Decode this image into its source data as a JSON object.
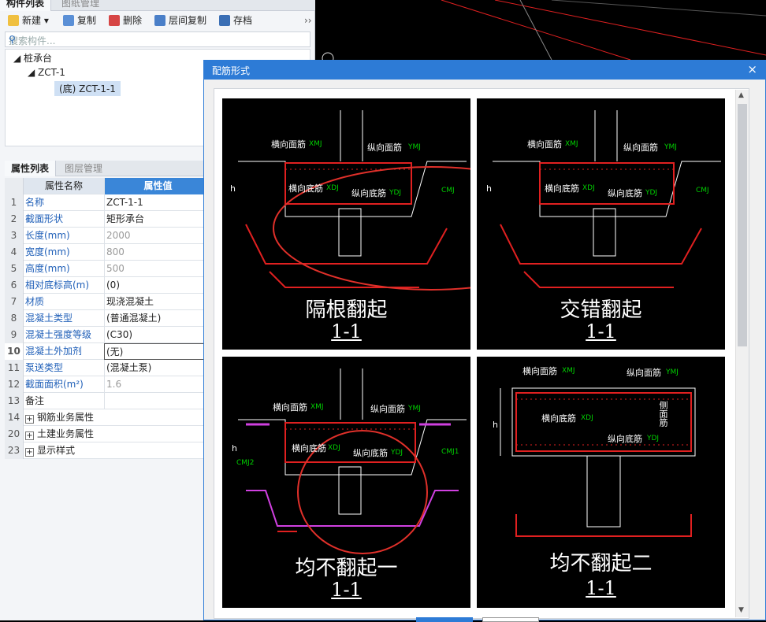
{
  "panel": {
    "tabs": [
      "构件列表",
      "图纸管理"
    ],
    "toolbar": {
      "new": "新建",
      "copy": "复制",
      "delete": "删除",
      "floor_copy": "层间复制",
      "save": "存档",
      "more": "››"
    },
    "search_placeholder": "搜索构件...",
    "tree": {
      "root": "桩承台",
      "child": "ZCT-1",
      "leaf": "(底) ZCT-1-1"
    }
  },
  "props": {
    "tabs": [
      "属性列表",
      "图层管理"
    ],
    "header": {
      "name": "属性名称",
      "value": "属性值"
    },
    "rows": [
      {
        "n": "1",
        "k": "名称",
        "v": "ZCT-1-1"
      },
      {
        "n": "2",
        "k": "截面形状",
        "v": "矩形承台"
      },
      {
        "n": "3",
        "k": "长度(mm)",
        "v": "2000"
      },
      {
        "n": "4",
        "k": "宽度(mm)",
        "v": "800"
      },
      {
        "n": "5",
        "k": "高度(mm)",
        "v": "500"
      },
      {
        "n": "6",
        "k": "相对底标高(m)",
        "v": "(0)"
      },
      {
        "n": "7",
        "k": "材质",
        "v": "现浇混凝土"
      },
      {
        "n": "8",
        "k": "混凝土类型",
        "v": "(普通混凝土)"
      },
      {
        "n": "9",
        "k": "混凝土强度等级",
        "v": "(C30)"
      },
      {
        "n": "10",
        "k": "混凝土外加剂",
        "v": "(无)"
      },
      {
        "n": "11",
        "k": "泵送类型",
        "v": "(混凝土泵)"
      },
      {
        "n": "12",
        "k": "截面面积(m²)",
        "v": "1.6"
      },
      {
        "n": "13",
        "k": "备注",
        "v": ""
      },
      {
        "n": "14",
        "k": "钢筋业务属性",
        "v": ""
      },
      {
        "n": "20",
        "k": "土建业务属性",
        "v": ""
      },
      {
        "n": "23",
        "k": "显示样式",
        "v": ""
      }
    ]
  },
  "dialog": {
    "title": "配筋形式",
    "close": "×",
    "section": "1-1",
    "cards": [
      {
        "title": "隔根翻起",
        "section": "1-1"
      },
      {
        "title": "交错翻起",
        "section": "1-1"
      },
      {
        "title": "均不翻起一",
        "section": "1-1"
      },
      {
        "title": "均不翻起二",
        "section": "1-1"
      }
    ],
    "rebar": {
      "top_h": "横向面筋",
      "top_v": "纵向面筋",
      "bot_h": "横向底筋",
      "bot_v": "纵向底筋",
      "side": "侧面筋",
      "xmj": "XMJ",
      "ymj": "YMJ",
      "xdj": "XDJ",
      "ydj": "YDJ",
      "cmj": "CMJ",
      "cmj1": "CMJ1",
      "cmj2": "CMJ2",
      "h": "h"
    }
  },
  "colors": {
    "accent": "#2d7bd6",
    "rebar": "#ff2020",
    "mark": "#e0302a"
  }
}
